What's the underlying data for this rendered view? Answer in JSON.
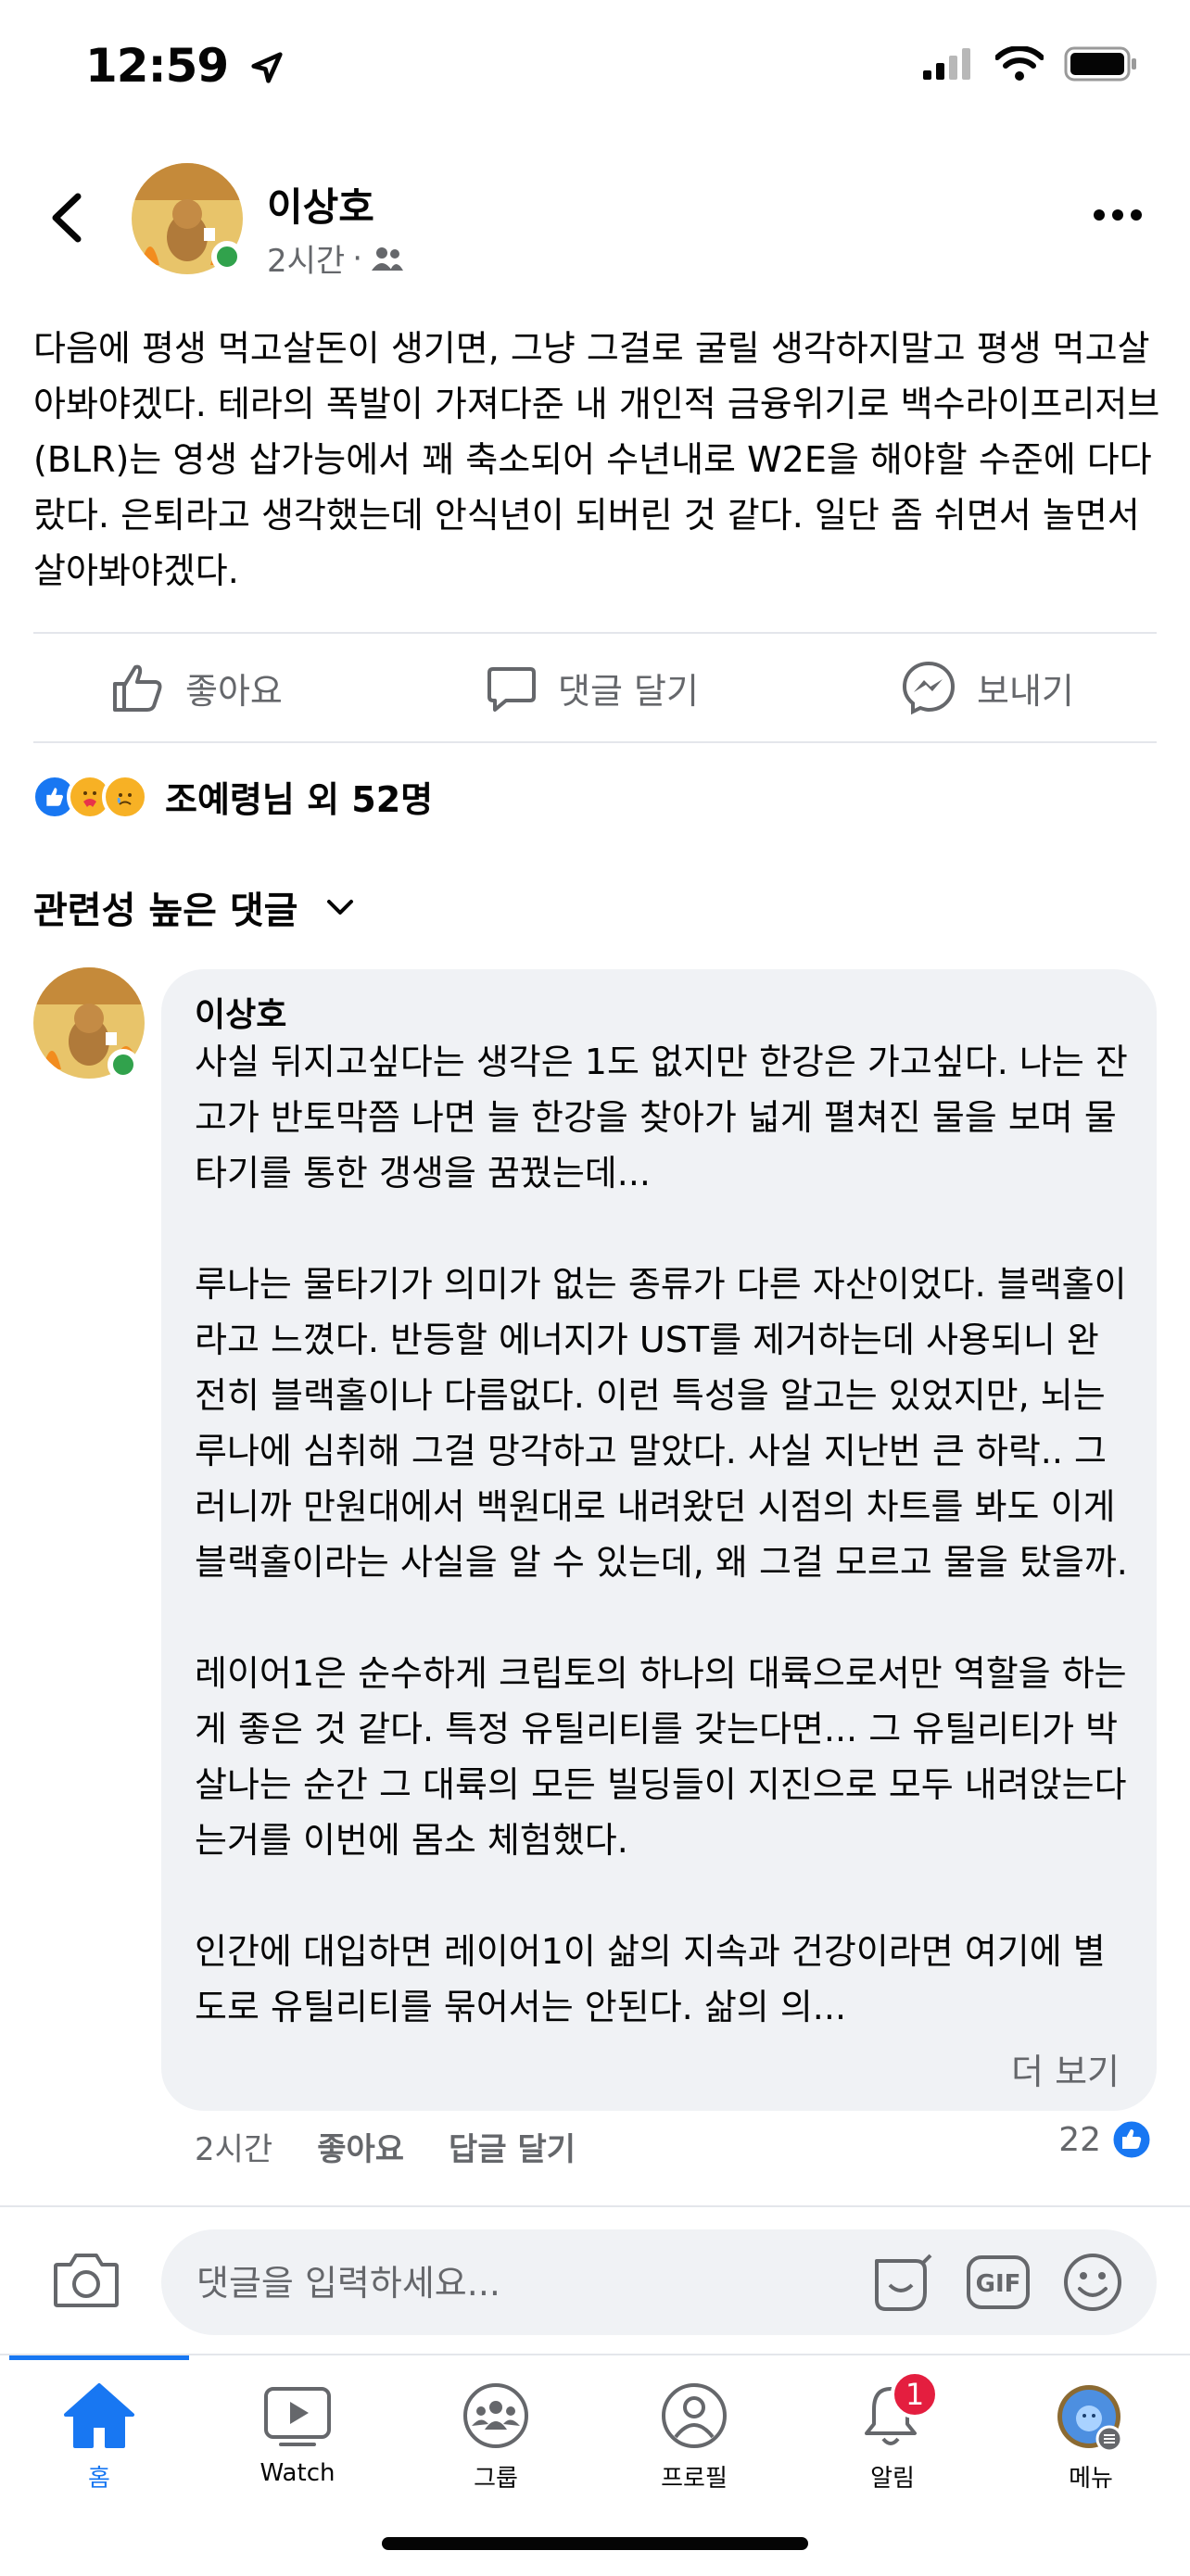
{
  "status_bar": {
    "time": "12:59"
  },
  "post": {
    "author": "이상호",
    "time": "2시간",
    "separator": "·",
    "audience_icon": "friends-icon",
    "body": "다음에 평생 먹고살돈이 생기면, 그냥 그걸로 굴릴 생각하지말고 평생 먹고살아봐야겠다. 테라의 폭발이 가져다준 내 개인적 금융위기로 백수라이프리저브(BLR)는 영생 삽가능에서 꽤 축소되어 수년내로 W2E을 해야할 수준에 다다랐다. 은퇴라고 생각했는데 안식년이 되버린 것 같다. 일단 좀 쉬면서 놀면서 살아봐야겠다."
  },
  "actions": {
    "like": "좋아요",
    "comment": "댓글 달기",
    "send": "보내기"
  },
  "reactions": {
    "summary": "조예령님 외 52명"
  },
  "comments_filter": {
    "label": "관련성 높은 댓글"
  },
  "comment": {
    "author": "이상호",
    "paragraphs": [
      "사실 뒤지고싶다는 생각은 1도 없지만 한강은 가고싶다. 나는 잔고가 반토막쯤 나면 늘 한강을 찾아가 넓게 펼쳐진 물을 보며 물타기를 통한 갱생을 꿈꿨는데...",
      "루나는 물타기가 의미가 없는 종류가 다른 자산이었다. 블랙홀이라고 느꼈다. 반등할 에너지가 UST를 제거하는데 사용되니 완전히 블랙홀이나 다름없다. 이런 특성을 알고는 있었지만, 뇌는 루나에 심취해 그걸 망각하고 말았다. 사실 지난번 큰 하락.. 그러니까 만원대에서 백원대로 내려왔던 시점의 차트를 봐도 이게 블랙홀이라는 사실을 알 수 있는데, 왜 그걸 모르고 물을 탔을까.",
      "레이어1은 순수하게 크립토의 하나의 대륙으로서만 역할을 하는게 좋은 것 같다. 특정 유틸리티를 갖는다면... 그 유틸리티가 박살나는 순간 그 대륙의 모든 빌딩들이 지진으로 모두 내려앉는다는거를 이번에 몸소 체험했다.",
      "인간에 대입하면 레이어1이 삶의 지속과 건강이라면 여기에 별도로 유틸리티를 묶어서는 안된다. 삶의 의..."
    ],
    "see_more": "더 보기",
    "time": "2시간",
    "like_label": "좋아요",
    "reply_label": "답글 달기",
    "like_count": "22"
  },
  "composer": {
    "placeholder": "댓글을 입력하세요..."
  },
  "tabs": [
    {
      "label": "홈",
      "icon": "home-icon"
    },
    {
      "label": "Watch",
      "icon": "watch-icon"
    },
    {
      "label": "그룹",
      "icon": "groups-icon"
    },
    {
      "label": "프로필",
      "icon": "profile-icon"
    },
    {
      "label": "알림",
      "icon": "bell-icon",
      "badge": "1"
    },
    {
      "label": "메뉴",
      "icon": "menu-avatar-icon"
    }
  ],
  "colors": {
    "accent": "#1877f2",
    "online": "#31a24c",
    "badge": "#e41e3f",
    "bubble": "#f0f2f5"
  }
}
